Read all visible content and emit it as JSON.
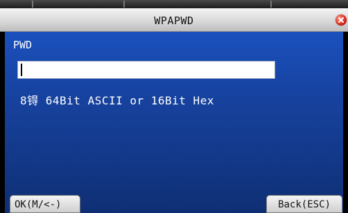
{
  "window": {
    "title": "WPAPWD"
  },
  "form": {
    "password_label": "PWD",
    "password_value": "",
    "hint": "8锝 64Bit ASCII or 16Bit Hex"
  },
  "footer": {
    "ok_label": "OK(M/<-)",
    "back_label": "Back(ESC)"
  },
  "icons": {
    "close": "close-icon"
  },
  "colors": {
    "content_background": "#1b50bd",
    "title_bar": "#d9d9d9",
    "close_button": "#d8261a"
  }
}
